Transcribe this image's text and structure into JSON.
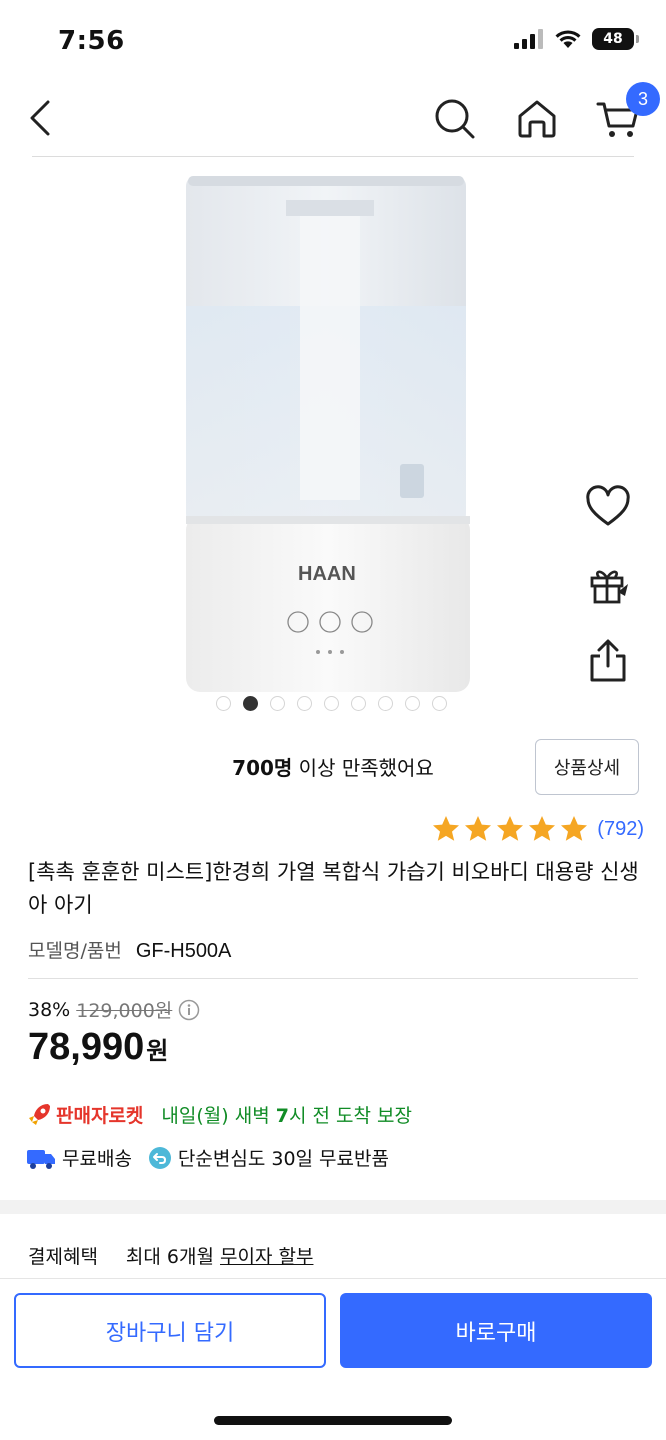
{
  "status_bar": {
    "time": "7:56",
    "battery": "48"
  },
  "nav": {
    "cart_count": "3"
  },
  "product": {
    "brand_text": "HAAN",
    "satisfaction_count": "700명",
    "satisfaction_text": " 이상 만족했어요",
    "detail_button": "상품상세",
    "rating_stars": 5,
    "review_count": "(792)",
    "title": "[촉촉 훈훈한 미스트]한경희 가열 복합식 가습기 비오바디 대용량 신생아 아기",
    "model_label": "모델명/품번",
    "model_value": "GF-H500A",
    "image_count": 9,
    "active_image": 2
  },
  "price": {
    "discount_rate": "38%",
    "original_price": "129,000원",
    "sale_price": "78,990",
    "currency": "원"
  },
  "delivery": {
    "rocket_label": "판매자로켓",
    "arrival_pre": "내일(월) 새벽 ",
    "arrival_bold": "7",
    "arrival_post": "시 전 도착 보장",
    "free_shipping": "무료배송",
    "return_text": "단순변심도 30일 무료반품"
  },
  "payment": {
    "label": "결제혜택",
    "text": "최대 6개월 ",
    "link": "무이자 할부"
  },
  "actions": {
    "add_to_cart": "장바구니 담기",
    "buy_now": "바로구매"
  },
  "colors": {
    "accent": "#346aff",
    "rocket_red": "#e5352b",
    "arrival_green": "#118c26",
    "star": "#f5a623"
  }
}
